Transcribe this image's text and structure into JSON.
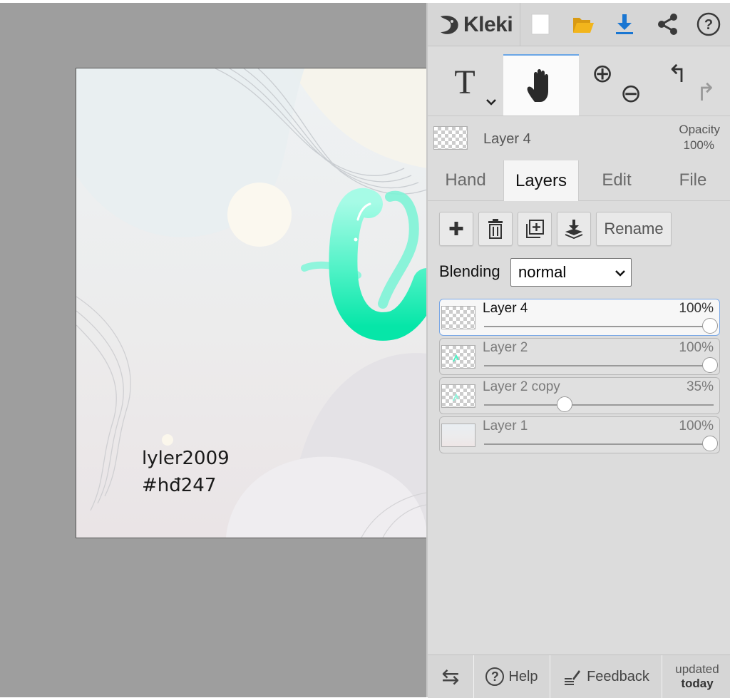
{
  "app": {
    "name": "Kleki"
  },
  "toolbar": {
    "icons": [
      "new-image-icon",
      "open-folder-icon",
      "download-icon",
      "share-icon",
      "help-icon"
    ],
    "colors": {
      "folder": "#f2b51c",
      "download": "#1976d2"
    }
  },
  "tools": {
    "text_glyph": "T",
    "hand_icon": "hand-icon",
    "zoom_in_glyph": "⊕",
    "zoom_out_glyph": "⊖",
    "undo_glyph": "↰",
    "redo_glyph": "↱"
  },
  "current_layer": {
    "name": "Layer 4",
    "opacity_label": "Opacity",
    "opacity_value": "100%"
  },
  "tabs": [
    {
      "label": "Hand"
    },
    {
      "label": "Layers",
      "active": true
    },
    {
      "label": "Edit"
    },
    {
      "label": "File"
    }
  ],
  "layer_actions": {
    "add_glyph": "✚",
    "rename_label": "Rename"
  },
  "blending": {
    "label": "Blending",
    "value": "normal"
  },
  "layers": [
    {
      "name": "Layer 4",
      "opacity": "100%",
      "opacity_fraction": 1.0,
      "selected": true
    },
    {
      "name": "Layer 2",
      "opacity": "100%",
      "opacity_fraction": 1.0,
      "selected": false
    },
    {
      "name": "Layer 2 copy",
      "opacity": "35%",
      "opacity_fraction": 0.35,
      "selected": false
    },
    {
      "name": "Layer 1",
      "opacity": "100%",
      "opacity_fraction": 1.0,
      "selected": false
    }
  ],
  "canvas": {
    "text_line1": "lyler2009",
    "text_line2": "#hđ247",
    "accent": "#3ff2c4"
  },
  "bottom": {
    "swap_glyph": "⇆",
    "help_label": "Help",
    "help_glyph": "?",
    "feedback_label": "Feedback",
    "updated_line1": "updated",
    "updated_line2": "today"
  }
}
